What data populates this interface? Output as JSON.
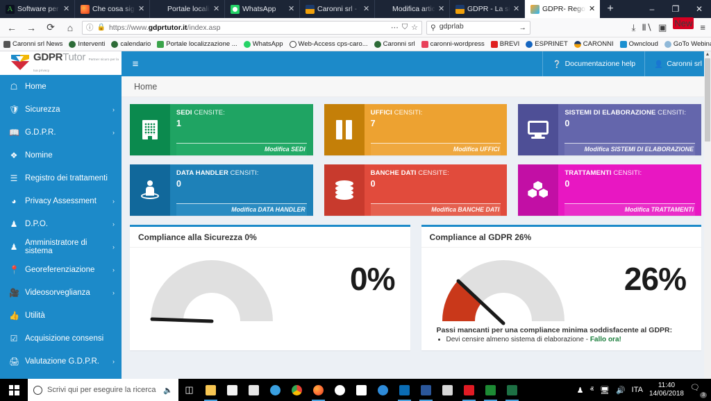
{
  "browser": {
    "tabs": [
      {
        "label": "Software per H...",
        "favicon": "green-doc-icon",
        "active": false
      },
      {
        "label": "Che cosa signifi",
        "favicon": "firefox-icon",
        "active": false
      },
      {
        "label": "Portale localizzazion",
        "favicon": "none-icon",
        "active": false
      },
      {
        "label": "WhatsApp",
        "favicon": "whatsapp-icon",
        "active": false
      },
      {
        "label": "Caronni srl - Sis",
        "favicon": "caronni-icon",
        "active": false
      },
      {
        "label": "Modifica articolo ‹ C",
        "favicon": "none-icon",
        "active": false
      },
      {
        "label": "GDPR - La sicur",
        "favicon": "caronni-icon",
        "active": false
      },
      {
        "label": "GDPR- Regolam",
        "favicon": "gdpr-icon",
        "active": true
      }
    ],
    "new_tab_label": "+",
    "window_controls": {
      "minimize": "–",
      "restore": "❐",
      "close": "✕"
    },
    "nav": {
      "back": "←",
      "forward": "→",
      "reload": "⟳",
      "home": "⌂",
      "info_icon": "ⓘ",
      "lock_icon": "🔒",
      "url_prefix": "https://www.",
      "url_domain": "gdprtutor.it",
      "url_path": "/index.asp",
      "more_icon": "⋯",
      "shield_icon": "⛉",
      "bookmark_star": "☆",
      "search_value": "gdprlab",
      "search_go": "→",
      "download_icon": "⤓",
      "library_icon": "Ⅱ∖",
      "sidebar_icon": "▣",
      "new_badge": "New",
      "menu_icon": "≡"
    },
    "bookmarks": [
      {
        "label": "Caronni srl News",
        "icon": "rss-icon"
      },
      {
        "label": "Interventi",
        "icon": "circle-a-icon"
      },
      {
        "label": "calendario",
        "icon": "circle-a-icon"
      },
      {
        "label": "Portale localizzazione ...",
        "icon": "signal-icon"
      },
      {
        "label": "WhatsApp",
        "icon": "whatsapp-icon"
      },
      {
        "label": "Web-Access cps-caro...",
        "icon": "globe-icon"
      },
      {
        "label": "Caronni srl",
        "icon": "circle-a-icon"
      },
      {
        "label": "caronni-wordpress",
        "icon": "asterisk-icon"
      },
      {
        "label": "BREVI",
        "icon": "brevi-icon"
      },
      {
        "label": "ESPRINET",
        "icon": "esprinet-icon"
      },
      {
        "label": "CARONNI",
        "icon": "caronni-icon"
      },
      {
        "label": "Owncloud",
        "icon": "cloud-icon"
      },
      {
        "label": "GoTo Webinar",
        "icon": "gotowebinar-icon"
      }
    ]
  },
  "app": {
    "brand": {
      "name_bold": "GDPR",
      "name_light": "Tutor",
      "tagline": "Partner sicuro per la tua privacy"
    },
    "header": {
      "hamburger": "≡",
      "help_label": "Documentazione help",
      "help_icon": "question-mark-icon",
      "user_label": "Caronni srl",
      "user_icon": "user-icon"
    },
    "breadcrumb": "Home",
    "sidebar": [
      {
        "label": "Home",
        "icon": "home-icon",
        "caret": ""
      },
      {
        "label": "Sicurezza",
        "icon": "shield-icon",
        "caret": "›"
      },
      {
        "label": "G.D.P.R.",
        "icon": "book-icon",
        "caret": "›"
      },
      {
        "label": "Nomine",
        "icon": "diamond-icon",
        "caret": ""
      },
      {
        "label": "Registro dei trattamenti",
        "icon": "list-icon",
        "caret": ""
      },
      {
        "label": "Privacy Assessment",
        "icon": "dashboard-icon",
        "caret": "›"
      },
      {
        "label": "D.P.O.",
        "icon": "person-tie-icon",
        "caret": "›"
      },
      {
        "label": "Amministratore di sistema",
        "icon": "person-tie-icon",
        "caret": "›"
      },
      {
        "label": "Georeferenziazione",
        "icon": "map-pin-icon",
        "caret": "›"
      },
      {
        "label": "Videosorveglianza",
        "icon": "video-camera-icon",
        "caret": "›"
      },
      {
        "label": "Utilità",
        "icon": "thumbs-up-icon",
        "caret": ""
      },
      {
        "label": "Acquisizione consensi",
        "icon": "checkbox-icon",
        "caret": ""
      },
      {
        "label": "Valutazione G.D.P.R.",
        "icon": "printer-icon",
        "caret": "›"
      }
    ],
    "cards": [
      {
        "title_bold": "SEDI",
        "title_rest": " CENSITE:",
        "value": "1",
        "footer": "Modifica SEDI",
        "icon": "building-icon",
        "color": "#1fa463",
        "icon_bg": "#0b8a4e",
        "foot_bg": "#23ab68"
      },
      {
        "title_bold": "UFFICI",
        "title_rest": " CENSITI:",
        "value": "7",
        "footer": "Modifica UFFICI",
        "icon": "pause-bars-icon",
        "color": "#eda231",
        "icon_bg": "#c47f08",
        "foot_bg": "#efa83f"
      },
      {
        "title_bold": "SISTEMI DI ELABORAZIONE",
        "title_rest": " CENSITI:",
        "value": "0",
        "footer": "Modifica SISTEMI DI ELABORAZIONE",
        "icon": "monitor-icon",
        "color": "#6466ac",
        "icon_bg": "#4e4f96",
        "foot_bg": "#7173b4"
      },
      {
        "title_bold": "DATA HANDLER",
        "title_rest": " CENSITI:",
        "value": "0",
        "footer": "Modifica DATA HANDLER",
        "icon": "person-location-icon",
        "color": "#1e81b8",
        "icon_bg": "#11689b",
        "foot_bg": "#2a8cc2"
      },
      {
        "title_bold": "BANCHE DATI",
        "title_rest": " CENSITE:",
        "value": "0",
        "footer": "Modifica BANCHE DATI",
        "icon": "database-icon",
        "color": "#e14b3c",
        "icon_bg": "#c83a2d",
        "foot_bg": "#e5604f"
      },
      {
        "title_bold": "TRATTAMENTI",
        "title_rest": " CENSITI:",
        "value": "0",
        "footer": "Modifica TRATTAMENTI",
        "icon": "cubes-icon",
        "color": "#e817c2",
        "icon_bg": "#c20fa5",
        "foot_bg": "#ea2ec9"
      }
    ],
    "panels": {
      "security": {
        "title": "Compliance alla Sicurezza 0%",
        "value_label": "0%"
      },
      "gdpr": {
        "title": "Compliance al GDPR 26%",
        "value_label": "26%",
        "missing_title": "Passi mancanti per una compliance minima soddisfacente al GDPR:",
        "missing_items": [
          {
            "text": "Devi censire almeno sistema di elaborazione - ",
            "link": "Fallo ora!"
          }
        ]
      }
    }
  },
  "chart_data": [
    {
      "type": "gauge",
      "title": "Compliance alla Sicurezza 0%",
      "value": 0,
      "unit": "%",
      "ylim": [
        0,
        100
      ],
      "label": "0%",
      "arc_color": "#c9381a",
      "track_color": "#e0e0e0",
      "needle_color": "#1a1a1a"
    },
    {
      "type": "gauge",
      "title": "Compliance al GDPR 26%",
      "value": 26,
      "unit": "%",
      "ylim": [
        0,
        100
      ],
      "label": "26%",
      "arc_color": "#c9381a",
      "track_color": "#e0e0e0",
      "needle_color": "#1a1a1a"
    }
  ],
  "taskbar": {
    "start_icon": "windows-logo-icon",
    "search_placeholder": "Scrivi qui per eseguire la ricerca",
    "mic_icon": "microphone-icon",
    "taskview_icon": "task-view-icon",
    "apps": [
      {
        "name": "file-explorer-icon",
        "color": "#f7c652"
      },
      {
        "name": "microsoft-store-icon",
        "color": "#f2f2f2"
      },
      {
        "name": "calculator-icon",
        "color": "#e6e6e6"
      },
      {
        "name": "paint-icon",
        "color": "#3aa0e0"
      },
      {
        "name": "chrome-icon",
        "color": "#4caf50"
      },
      {
        "name": "firefox-icon",
        "color": "#ff7139"
      },
      {
        "name": "anydesk-icon",
        "color": "#e02020"
      },
      {
        "name": "mail-icon",
        "color": "#ffffff"
      },
      {
        "name": "edge-icon",
        "color": "#2e8bd9"
      },
      {
        "name": "outlook-icon",
        "color": "#0a6cb5"
      },
      {
        "name": "word-icon",
        "color": "#2b579a"
      },
      {
        "name": "sticky-notes-icon",
        "color": "#d7d7d7"
      },
      {
        "name": "onenote-red-icon",
        "color": "#e01b24"
      },
      {
        "name": "green-l-app-icon",
        "color": "#1d8a34"
      },
      {
        "name": "excel-icon",
        "color": "#1d7044"
      }
    ],
    "tray": {
      "people_icon": "people-icon",
      "chevron_icon": "ⱏ",
      "network_icon": "network-icon",
      "volume_icon": "volume-icon",
      "language": "ITA",
      "time": "11:40",
      "date": "14/06/2018",
      "notification_icon": "notification-icon",
      "notification_count": "3"
    }
  }
}
